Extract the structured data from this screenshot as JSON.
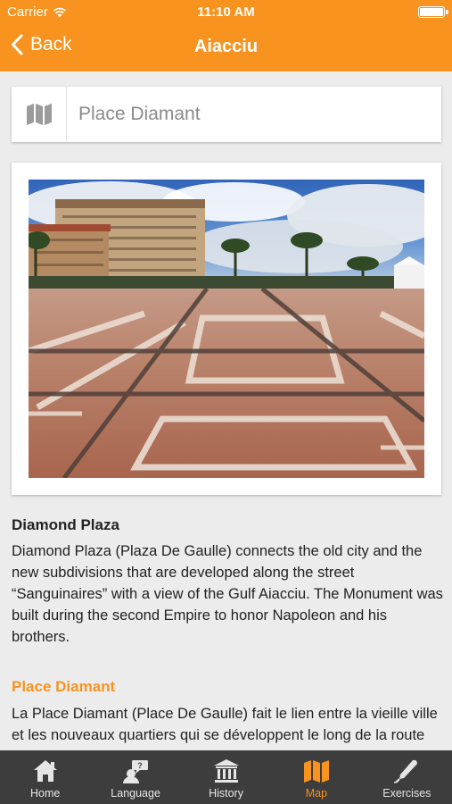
{
  "status_bar": {
    "carrier": "Carrier",
    "time": "11:10 AM"
  },
  "nav": {
    "back_label": "Back",
    "title": "Aiacciu"
  },
  "place_card": {
    "name": "Place Diamant",
    "icon": "map-icon"
  },
  "photo": {
    "alt": "Place Diamant"
  },
  "article": {
    "english_title": "Diamond Plaza",
    "english_body": "Diamond Plaza (Plaza De Gaulle) connects the old city and the new subdivisions that are developed along the street “Sanguinaires” with a view of the Gulf Aiacciu. The Monument was built during the second Empire to honor Napoleon and his brothers.",
    "local_title": "Place Diamant",
    "local_body": "La Place Diamant (Place De Gaulle) fait le lien entre la vieille ville et les nouveaux quartiers qui se développent le long de la route des Sanguinaires offrant une vue sur le golfe d'Ajaccio."
  },
  "tabs": [
    {
      "label": "Home",
      "icon": "home-icon"
    },
    {
      "label": "Language",
      "icon": "language-icon"
    },
    {
      "label": "History",
      "icon": "history-icon"
    },
    {
      "label": "Map",
      "icon": "map-icon",
      "active": true
    },
    {
      "label": "Exercises",
      "icon": "exercises-icon"
    }
  ],
  "colors": {
    "accent": "#f7931e",
    "tabbar": "#3d3d3d",
    "background": "#ececec"
  }
}
